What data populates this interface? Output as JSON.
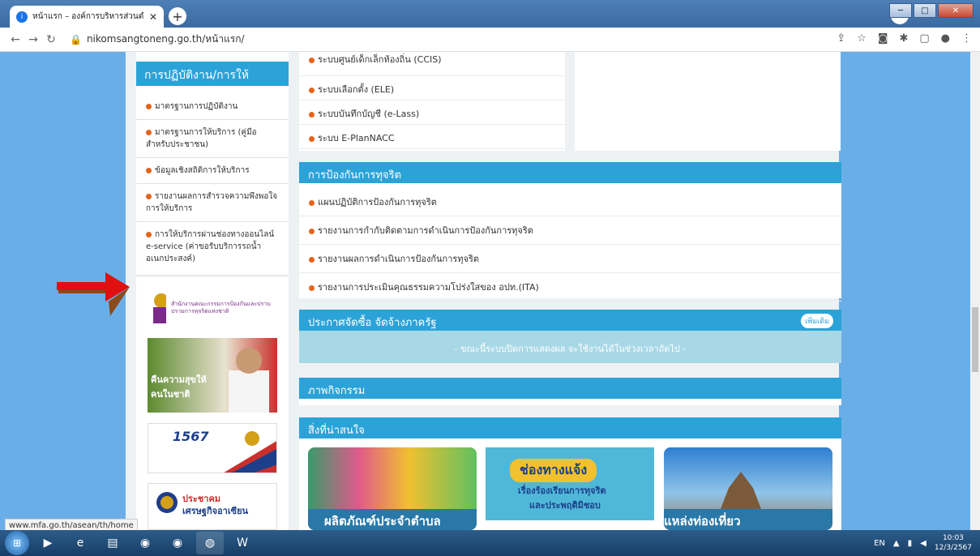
{
  "browser": {
    "tab_title": "หน้าแรก – องค์การบริหารส่วนตำบล",
    "url": "nikomsangtoneng.go.th/หน้าแรก/",
    "status_url": "www.mfa.go.th/asean/th/home"
  },
  "left_menu": {
    "title": "การปฏิบัติงาน/การให้บริการ",
    "items": [
      "มาตรฐานการปฏิบัติงาน",
      "มาตรฐานการให้บริการ (คู่มือสำหรับประชาชน)",
      "ข้อมูลเชิงสถิติการให้บริการ",
      "รายงานผลการสำรวจความพึงพอใจการให้บริการ",
      "การให้บริการผ่านช่องทางออนไลน์ e-service (ค่าขอรับบริการรถน้ำอเนกประสงค์)"
    ]
  },
  "banners": {
    "nacc_text": "สำนักงานคณะกรรมการป้องกันและปราบปรามการทุจริตแห่งชาติ",
    "pm_slogan": "คืนความสุขให้คนในชาติ",
    "hotline": "1567",
    "asean_line1": "ประชาคม",
    "asean_line2": "เศรษฐกิจอาเซียน"
  },
  "systems": {
    "items": [
      "ระบบศูนย์เด็กเล็กท้องถิ่น (CCIS)",
      "ระบบเลือกตั้ง (ELE)",
      "ระบบบันทึกบัญชี (e-Lass)",
      "ระบบ E-PlanNACC"
    ]
  },
  "anti_corruption": {
    "title": "การป้องกันการทุจริต",
    "items": [
      "แผนปฏิบัติการป้องกันการทุจริต",
      "รายงานการกำกับติดตามการดำเนินการป้องกันการทุจริต",
      "รายงานผลการดำเนินการป้องกันการทุจริต",
      "รายงานการประเมินคุณธรรมความโปร่งใสของ อปท.(ITA)"
    ]
  },
  "procurement": {
    "title": "ประกาศจัดซื้อ จัดจ้างภาครัฐ",
    "more": "เพิ่มเติม",
    "notice": "- ขณะนี้ระบบปิดการแสดงผล จะใช้งานได้ในช่วงเวลาถัดไป -"
  },
  "activities": {
    "title": "ภาพกิจกรรม"
  },
  "interesting": {
    "title": "สิ่งที่น่าสนใจ",
    "card1": "ผลิตภัณฑ์ประจำตำบล",
    "card2_title": "ช่องทางแจ้ง",
    "card2_sub1": "เรื่องร้องเรียนการทุจริต",
    "card2_sub2": "และประพฤติมิชอบ",
    "card3": "แหล่งท่องเที่ยว"
  },
  "taskbar": {
    "lang": "EN",
    "time": "10:03",
    "date": "12/3/2567"
  }
}
